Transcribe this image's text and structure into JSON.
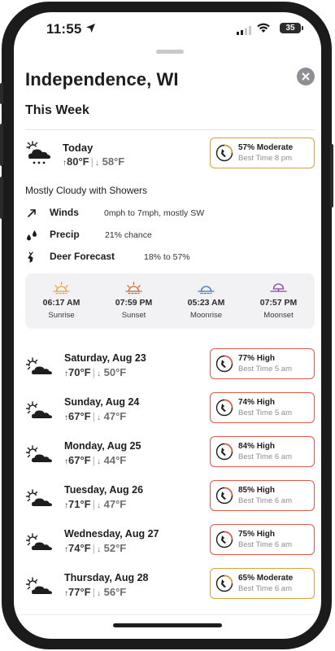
{
  "status_bar": {
    "time": "11:55",
    "battery": "35"
  },
  "header": {
    "city": "Independence, WI",
    "section_title": "This Week"
  },
  "today": {
    "day": "Today",
    "high": "80°F",
    "low": "58°F",
    "badge": {
      "percent_label": "57% Moderate",
      "best_time": "Best Time 8 pm",
      "level": "moderate"
    },
    "summary": "Mostly Cloudy with Showers",
    "details": [
      {
        "icon": "wind-arrow-icon",
        "label": "Winds",
        "value": "0mph to 7mph, mostly SW"
      },
      {
        "icon": "raindrops-icon",
        "label": "Precip",
        "value": "21% chance"
      },
      {
        "icon": "deer-icon",
        "label": "Deer Forecast",
        "value": "18% to 57%"
      }
    ]
  },
  "astro": [
    {
      "icon": "sunrise-icon",
      "time": "06:17 AM",
      "label": "Sunrise",
      "color": "#e3a23a"
    },
    {
      "icon": "sunset-icon",
      "time": "07:59 PM",
      "label": "Sunset",
      "color": "#c9662c"
    },
    {
      "icon": "moonrise-icon",
      "time": "05:23 AM",
      "label": "Moonrise",
      "color": "#3a6fb8"
    },
    {
      "icon": "moonset-icon",
      "time": "07:57 PM",
      "label": "Moonset",
      "color": "#8a3fa8"
    }
  ],
  "forecast": [
    {
      "day": "Saturday, Aug 23",
      "high": "70°F",
      "low": "50°F",
      "badge": {
        "percent_label": "77% High",
        "best_time": "Best Time 5 am",
        "level": "high"
      }
    },
    {
      "day": "Sunday, Aug 24",
      "high": "67°F",
      "low": "47°F",
      "badge": {
        "percent_label": "74% High",
        "best_time": "Best Time 5 am",
        "level": "high"
      }
    },
    {
      "day": "Monday, Aug 25",
      "high": "67°F",
      "low": "44°F",
      "badge": {
        "percent_label": "84% High",
        "best_time": "Best Time 6 am",
        "level": "high"
      }
    },
    {
      "day": "Tuesday, Aug 26",
      "high": "71°F",
      "low": "47°F",
      "badge": {
        "percent_label": "85% High",
        "best_time": "Best Time 6 am",
        "level": "high"
      }
    },
    {
      "day": "Wednesday, Aug 27",
      "high": "74°F",
      "low": "52°F",
      "badge": {
        "percent_label": "75% High",
        "best_time": "Best Time 6 am",
        "level": "high"
      }
    },
    {
      "day": "Thursday, Aug 28",
      "high": "77°F",
      "low": "56°F",
      "badge": {
        "percent_label": "65% Moderate",
        "best_time": "Best Time 6 am",
        "level": "moderate"
      }
    }
  ],
  "colors": {
    "moderate_border": "#d9a23a",
    "high_border": "#e05a4a"
  }
}
